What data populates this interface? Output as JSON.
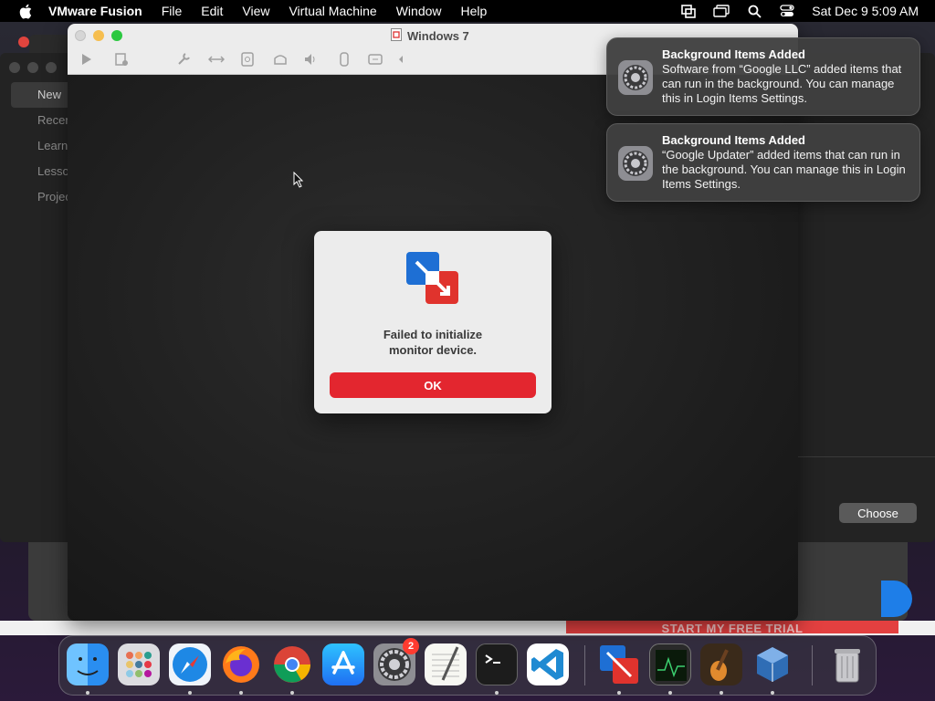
{
  "menubar": {
    "app_name": "VMware Fusion",
    "items": [
      "File",
      "Edit",
      "View",
      "Virtual Machine",
      "Window",
      "Help"
    ],
    "clock": "Sat Dec 9  5:09 AM"
  },
  "library_window": {
    "sidebar": [
      "New",
      "Recent",
      "Learn",
      "Lessons",
      "Projects"
    ],
    "choose_label": "Choose"
  },
  "vm_window": {
    "title": "Windows 7"
  },
  "alert": {
    "message_line1": "Failed to initialize",
    "message_line2": "monitor device.",
    "ok_label": "OK"
  },
  "notifications": [
    {
      "title": "Background Items Added",
      "body": "Software from “Google LLC” added items that can run in the background. You can manage this in Login Items Settings."
    },
    {
      "title": "Background Items Added",
      "body": "“Google Updater” added items that can run in the background. You can manage this in Login Items Settings."
    }
  ],
  "trial_banner": "START MY FREE TRIAL",
  "dock": {
    "settings_badge": "2",
    "items": [
      "finder-icon",
      "launchpad-icon",
      "safari-icon",
      "firefox-icon",
      "chrome-icon",
      "app-store-icon",
      "system-settings-icon",
      "textedit-icon",
      "terminal-icon",
      "vscode-icon",
      "vmware-fusion-icon",
      "activity-monitor-icon",
      "garageband-icon",
      "virtualbox-icon",
      "trash-icon"
    ]
  },
  "colors": {
    "ok_button": "#e3262f",
    "vmware_blue": "#1e6fd4",
    "vmware_red": "#e0332d"
  }
}
